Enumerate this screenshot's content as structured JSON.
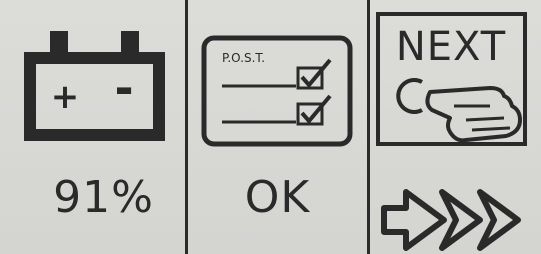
{
  "battery": {
    "icon": "battery-icon",
    "plus_sign": "+",
    "minus_sign": "-",
    "percent": "91%"
  },
  "post": {
    "icon": "post-checklist-icon",
    "label": "P.O.S.T.",
    "status": "OK"
  },
  "next": {
    "icon": "hand-pointing-icon",
    "label": "NEXT",
    "arrow_icon": "double-arrow-icon"
  },
  "colors": {
    "background": "#d7d7d4",
    "foreground": "#2a2a2a"
  }
}
